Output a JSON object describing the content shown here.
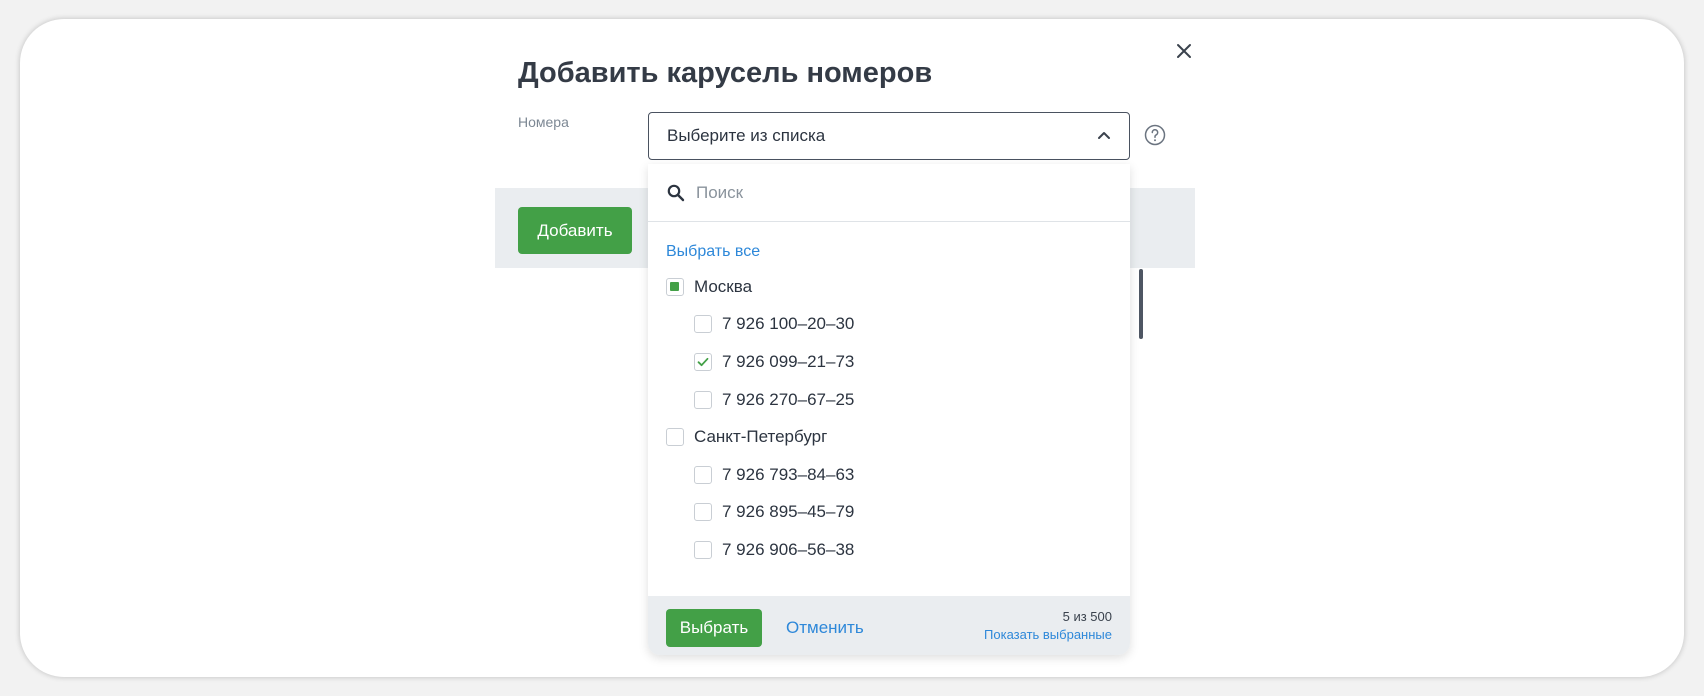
{
  "dialog": {
    "title": "Добавить карусель номеров",
    "field_label": "Номера",
    "select_placeholder": "Выберите из списка",
    "add_label": "Добавить"
  },
  "dropdown": {
    "search_placeholder": "Поиск",
    "select_all": "Выбрать все",
    "groups": [
      {
        "name": "Москва",
        "state": "partial",
        "items": [
          {
            "label": "7 926 100–20–30",
            "checked": false
          },
          {
            "label": "7 926 099–21–73",
            "checked": true
          },
          {
            "label": "7 926 270–67–25",
            "checked": false
          }
        ]
      },
      {
        "name": "Санкт-Петербург",
        "state": "unchecked",
        "items": [
          {
            "label": "7 926 793–84–63",
            "checked": false
          },
          {
            "label": "7 926 895–45–79",
            "checked": false
          },
          {
            "label": "7 926 906–56–38",
            "checked": false
          }
        ]
      }
    ],
    "footer": {
      "choose_label": "Выбрать",
      "cancel_label": "Отменить",
      "count": "5 из 500",
      "show_selected": "Показать выбранные"
    }
  },
  "icons": {
    "close": "close-icon",
    "chevron": "chevron-up-icon",
    "help": "help-circle-icon",
    "search": "search-icon",
    "check": "check-icon"
  },
  "colors": {
    "accent_green": "#43a047",
    "link_blue": "#2e88d9",
    "band_gray": "#eaedf0"
  }
}
